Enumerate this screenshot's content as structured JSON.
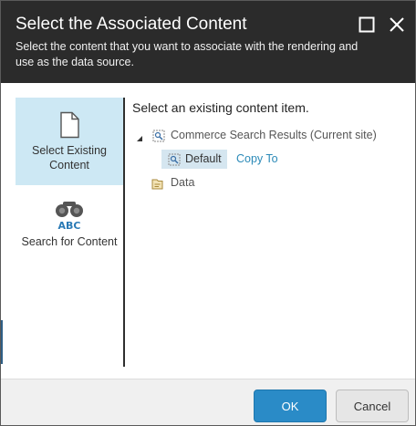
{
  "dialog": {
    "title": "Select the Associated Content",
    "subtitle": "Select the content that you want to associate with the rendering and use as the data source.",
    "maximize_icon": "maximize-icon",
    "close_icon": "close-icon"
  },
  "nav": {
    "items": [
      {
        "label": "Select Existing Content",
        "icon": "document-icon",
        "selected": true
      },
      {
        "label": "Search for Content",
        "icon": "binoculars-icon",
        "icon_text": "ABC",
        "selected": false
      }
    ]
  },
  "main": {
    "heading": "Select an existing content item.",
    "tree": {
      "root": {
        "label": "Commerce Search Results (Current site)",
        "icon": "search-results-icon",
        "expanded": true
      },
      "children": [
        {
          "label": "Default",
          "icon": "search-results-icon",
          "selected": true,
          "action": "Copy To"
        }
      ],
      "sibling": {
        "label": "Data",
        "icon": "data-folder-icon"
      }
    }
  },
  "footer": {
    "ok_label": "OK",
    "cancel_label": "Cancel"
  },
  "colors": {
    "header_bg": "#2b2b2b",
    "selected_nav_bg": "#cde8f4",
    "selected_tree_bg": "#d5e6f0",
    "link": "#2b8ab8",
    "primary_button": "#2a8bc7"
  }
}
